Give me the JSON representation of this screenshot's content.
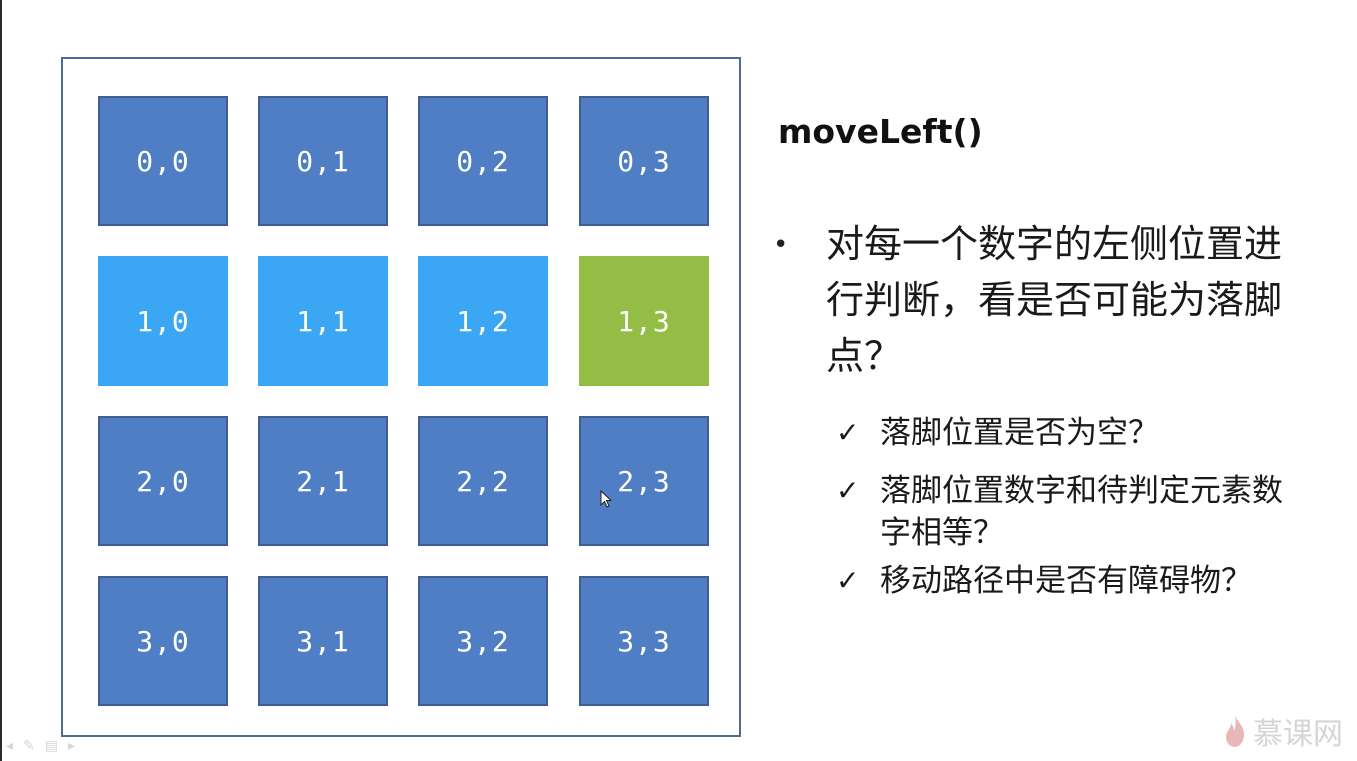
{
  "title": "moveLeft()",
  "main_point": "对每一个数字的左侧位置进行判断，看是否可能为落脚点？",
  "checks": [
    "落脚位置是否为空？",
    "落脚位置数字和待判定元素数字相等？",
    "移动路径中是否有障碍物？"
  ],
  "grid": [
    [
      "0,0",
      "0,1",
      "0,2",
      "0,3"
    ],
    [
      "1,0",
      "1,1",
      "1,2",
      "1,3"
    ],
    [
      "2,0",
      "2,1",
      "2,2",
      "2,3"
    ],
    [
      "3,0",
      "3,1",
      "3,2",
      "3,3"
    ]
  ],
  "colors": {
    "cell_default": "#4f7ec4",
    "cell_highlight": "#3ba6f4",
    "cell_current": "#93bd44"
  },
  "watermark": "慕课网",
  "icons": {
    "bullet": "bullet-dot",
    "check": "check-icon",
    "cursor": "mouse-cursor-icon",
    "watermark_logo": "flame-icon"
  }
}
